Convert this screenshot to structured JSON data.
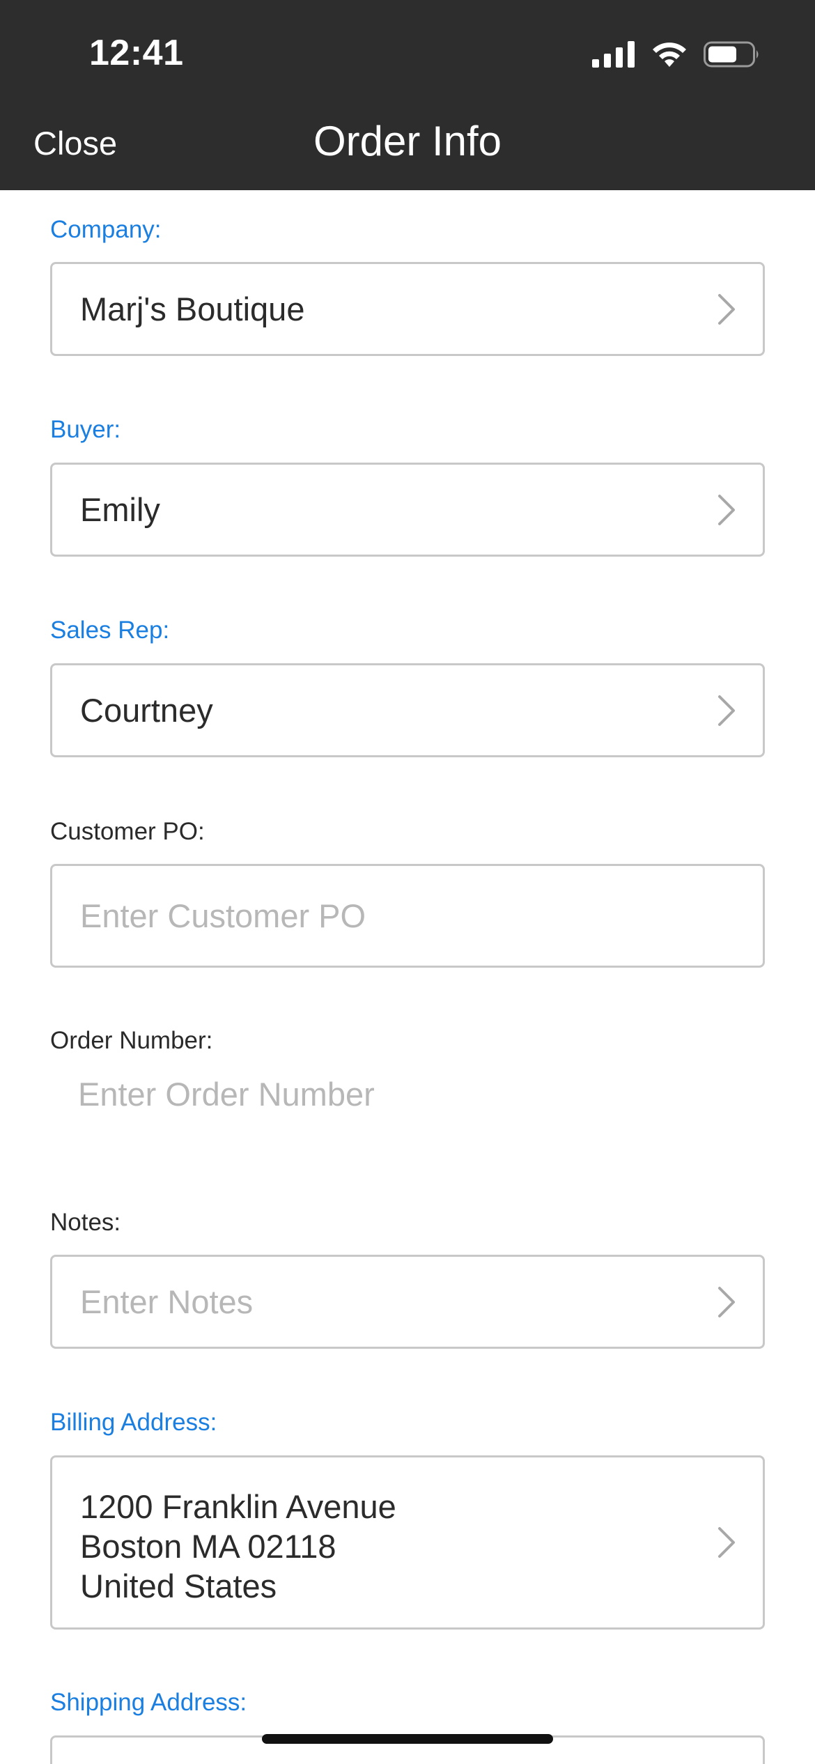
{
  "status_bar": {
    "time": "12:41"
  },
  "nav": {
    "close_label": "Close",
    "title": "Order Info"
  },
  "form": {
    "company": {
      "label": "Company:",
      "value": "Marj's Boutique"
    },
    "buyer": {
      "label": "Buyer:",
      "value": "Emily"
    },
    "sales_rep": {
      "label": "Sales Rep:",
      "value": "Courtney"
    },
    "customer_po": {
      "label": "Customer PO:",
      "placeholder": "Enter Customer PO"
    },
    "order_number": {
      "label": "Order Number:",
      "placeholder": "Enter Order Number"
    },
    "notes": {
      "label": "Notes:",
      "placeholder": "Enter Notes"
    },
    "billing_address": {
      "label": "Billing Address:",
      "lines": [
        "1200 Franklin Avenue",
        "Boston MA 02118",
        "United States"
      ]
    },
    "shipping_address": {
      "label": "Shipping Address:"
    }
  },
  "colors": {
    "header_bg": "#2d2d2d",
    "accent_label": "#1a7fe0",
    "placeholder": "#b7b7b7",
    "border": "#c8c8c8"
  },
  "icons": {
    "signal": "cellular-signal-icon",
    "wifi": "wifi-icon",
    "battery": "battery-icon",
    "chevron": "chevron-right-icon"
  }
}
